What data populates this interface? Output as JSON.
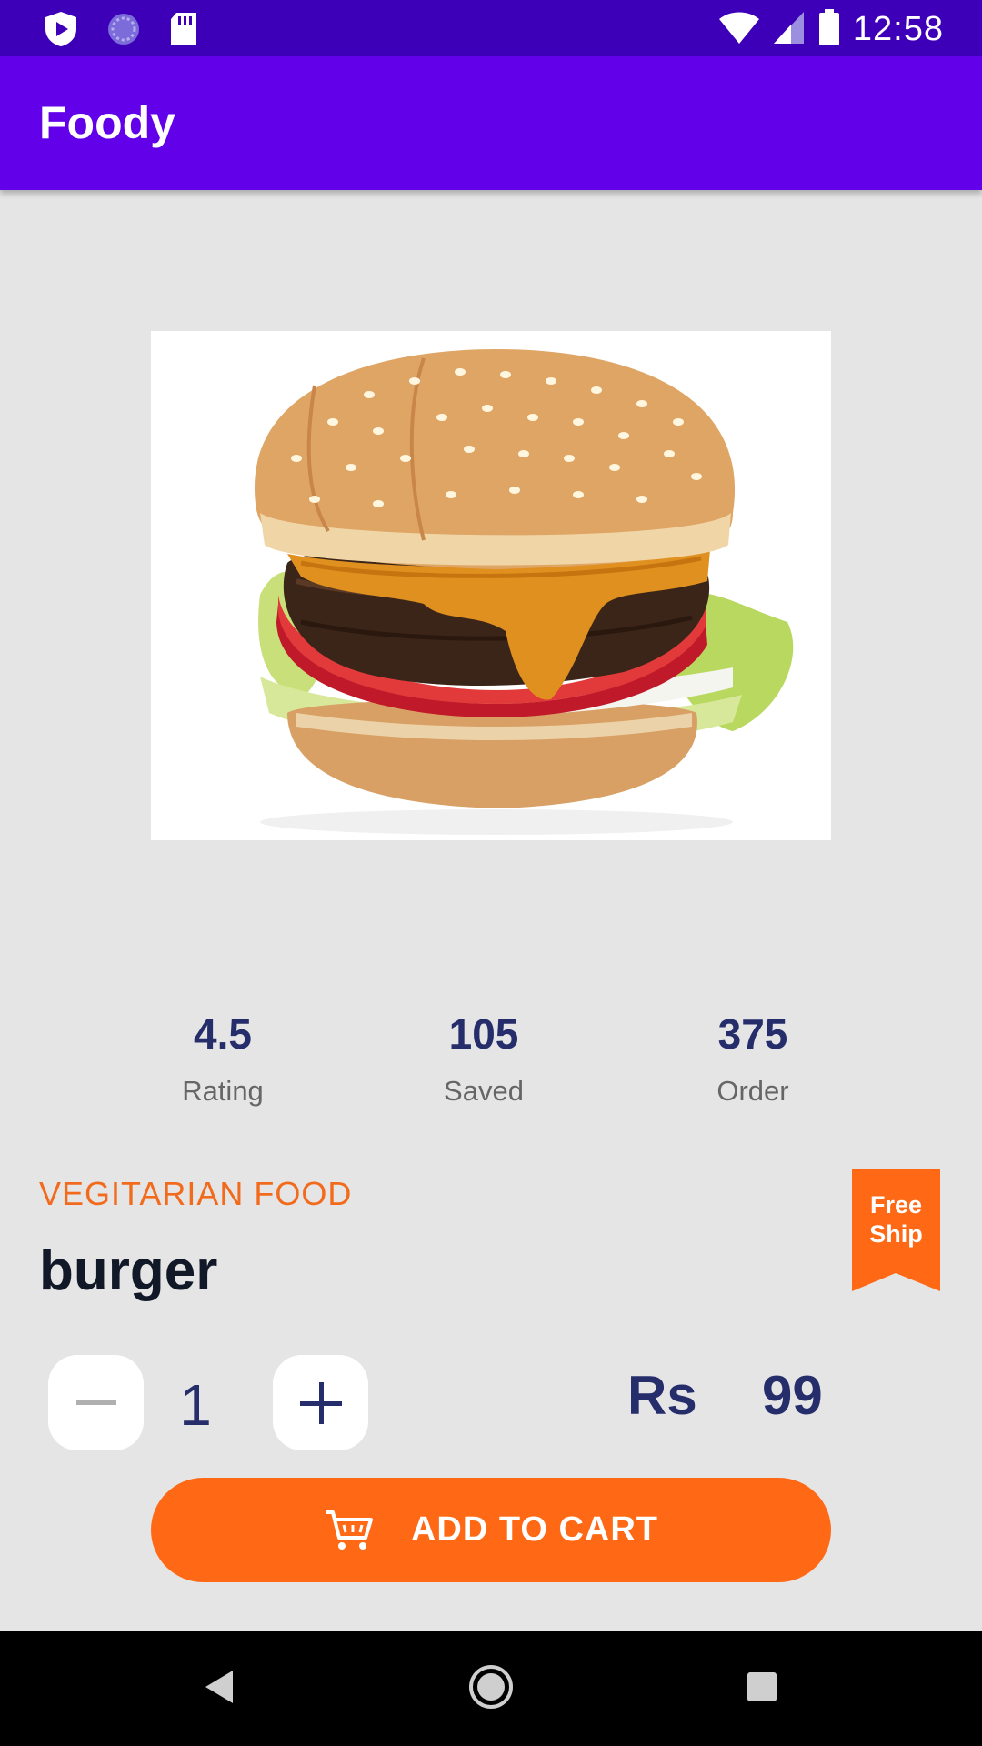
{
  "status_bar": {
    "time": "12:58",
    "icons": [
      "shield-play-icon",
      "loading-circle-icon",
      "sd-card-icon",
      "wifi-icon",
      "signal-icon",
      "battery-icon"
    ]
  },
  "app_bar": {
    "title": "Foody"
  },
  "food": {
    "image": "burger-image",
    "category": "VEGITARIAN FOOD",
    "name": "burger"
  },
  "stats": [
    {
      "value": "4.5",
      "label": "Rating"
    },
    {
      "value": "105",
      "label": "Saved"
    },
    {
      "value": "375",
      "label": "Order"
    }
  ],
  "badge": {
    "line1": "Free",
    "line2": "Ship",
    "color": "#ff6915"
  },
  "quantity": {
    "value": "1"
  },
  "price": {
    "currency": "Rs",
    "amount": "99"
  },
  "cart_button": {
    "label": "ADD TO CART",
    "color": "#ff6915"
  },
  "nav_bar": {
    "icons": [
      "back-icon",
      "home-icon",
      "recents-icon"
    ]
  },
  "colors": {
    "primary": "#6200ea",
    "status": "#3d00b8",
    "accent": "#ff6915",
    "text_dark": "#262d6b"
  }
}
